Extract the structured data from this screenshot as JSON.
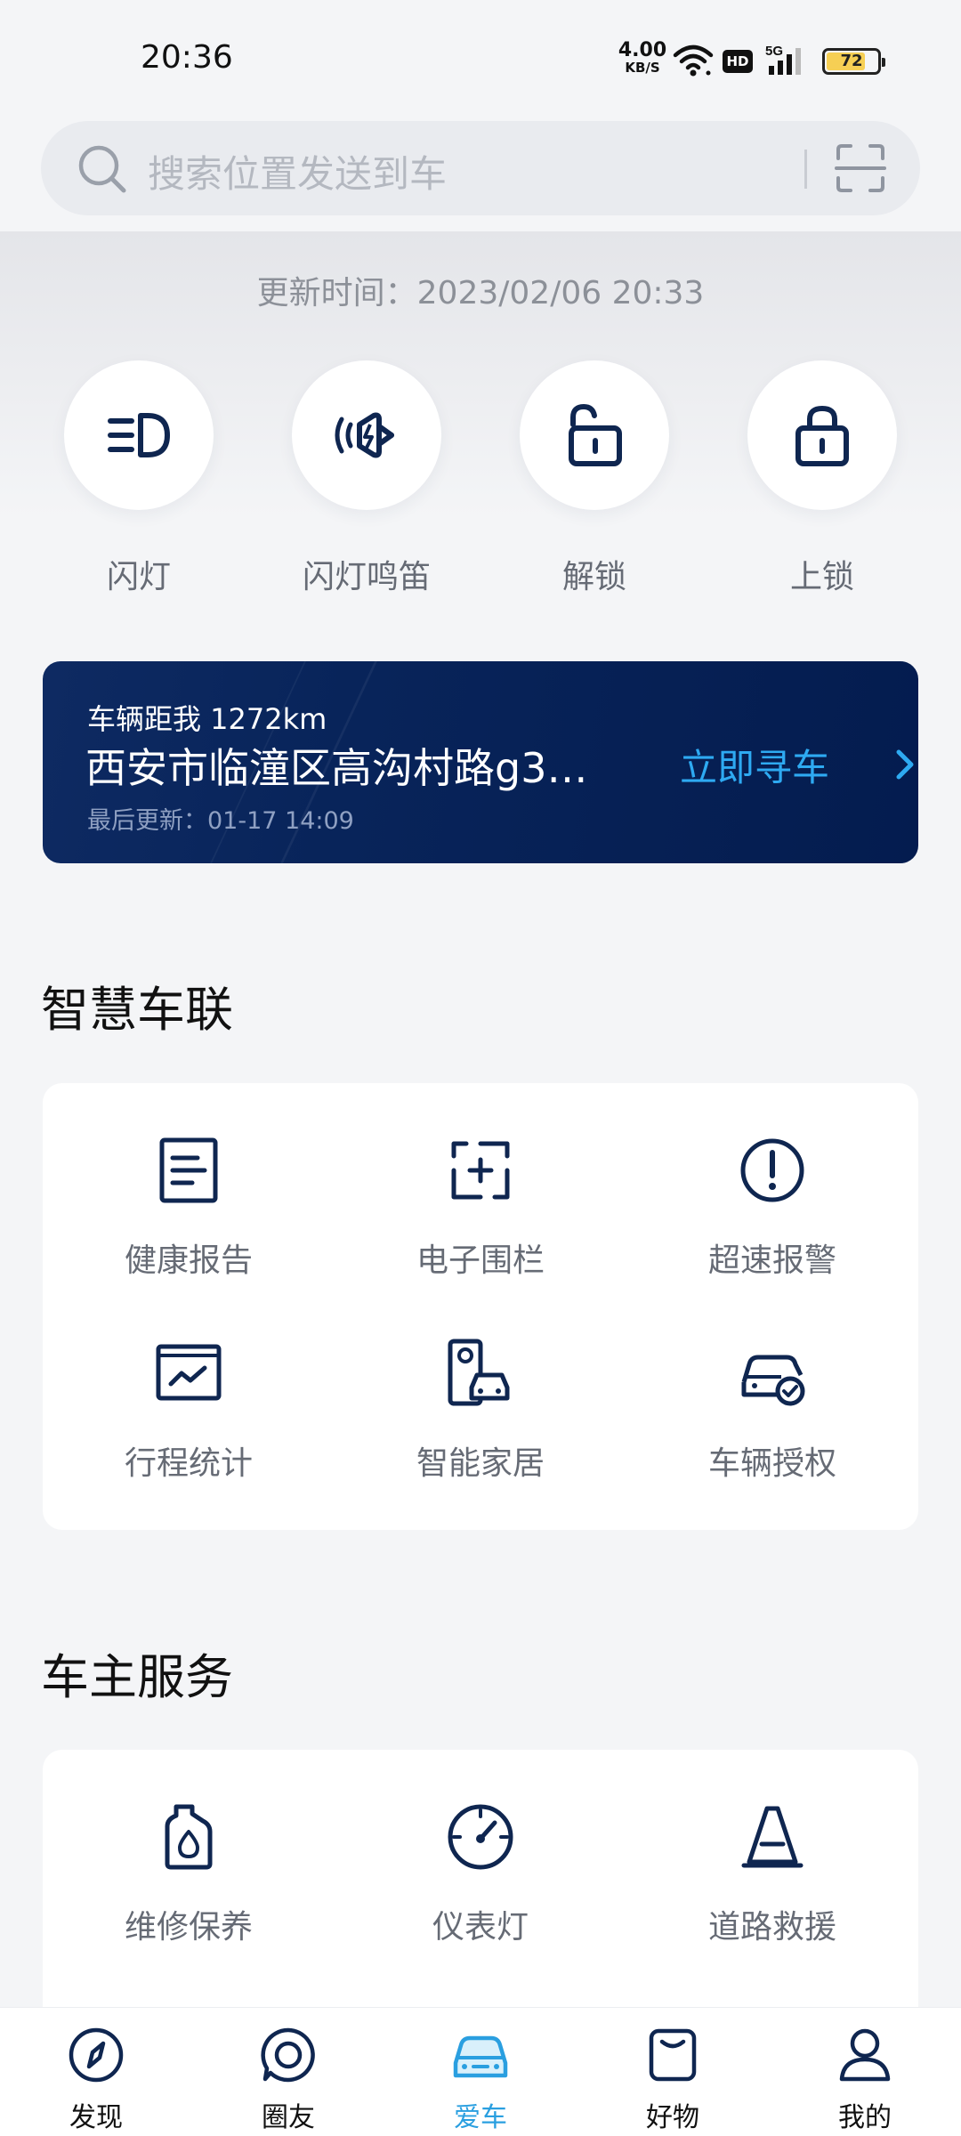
{
  "status_bar": {
    "time": "20:36",
    "net_speed_value": "4.00",
    "net_speed_unit": "KB/S",
    "hd": "HD",
    "signal": "5G",
    "battery": "72"
  },
  "search": {
    "placeholder": "搜索位置发送到车"
  },
  "update_time": "更新时间：2023/02/06 20:33",
  "quick_actions": [
    {
      "label": "闪灯",
      "icon": "headlight-icon"
    },
    {
      "label": "闪灯鸣笛",
      "icon": "horn-icon"
    },
    {
      "label": "解锁",
      "icon": "unlock-icon"
    },
    {
      "label": "上锁",
      "icon": "lock-icon"
    }
  ],
  "location_card": {
    "distance": "车辆距我 1272km",
    "address": "西安市临潼区高沟村路g3…",
    "last_update": "最后更新：01-17 14:09",
    "action": "立即寻车"
  },
  "smart_section": {
    "title": "智慧车联",
    "items": [
      {
        "label": "健康报告",
        "icon": "health-report-icon"
      },
      {
        "label": "电子围栏",
        "icon": "geofence-icon"
      },
      {
        "label": "超速报警",
        "icon": "speed-alarm-icon"
      },
      {
        "label": "行程统计",
        "icon": "trip-stats-icon"
      },
      {
        "label": "智能家居",
        "icon": "smart-home-icon"
      },
      {
        "label": "车辆授权",
        "icon": "vehicle-authorization-icon"
      }
    ]
  },
  "owner_section": {
    "title": "车主服务",
    "items": [
      {
        "label": "维修保养",
        "icon": "oil-bottle-icon"
      },
      {
        "label": "仪表灯",
        "icon": "gauge-icon"
      },
      {
        "label": "道路救援",
        "icon": "road-cone-icon"
      }
    ]
  },
  "bottom_nav": [
    {
      "label": "发现",
      "icon": "compass-icon",
      "active": false
    },
    {
      "label": "圈友",
      "icon": "chat-circle-icon",
      "active": false
    },
    {
      "label": "爱车",
      "icon": "car-icon",
      "active": true
    },
    {
      "label": "好物",
      "icon": "shopping-bag-icon",
      "active": false
    },
    {
      "label": "我的",
      "icon": "user-icon",
      "active": false
    }
  ],
  "colors": {
    "accent": "#2a9fe0",
    "card_navy": "#061f52",
    "icon_navy": "#0f2650",
    "background": "#f4f5f7"
  }
}
